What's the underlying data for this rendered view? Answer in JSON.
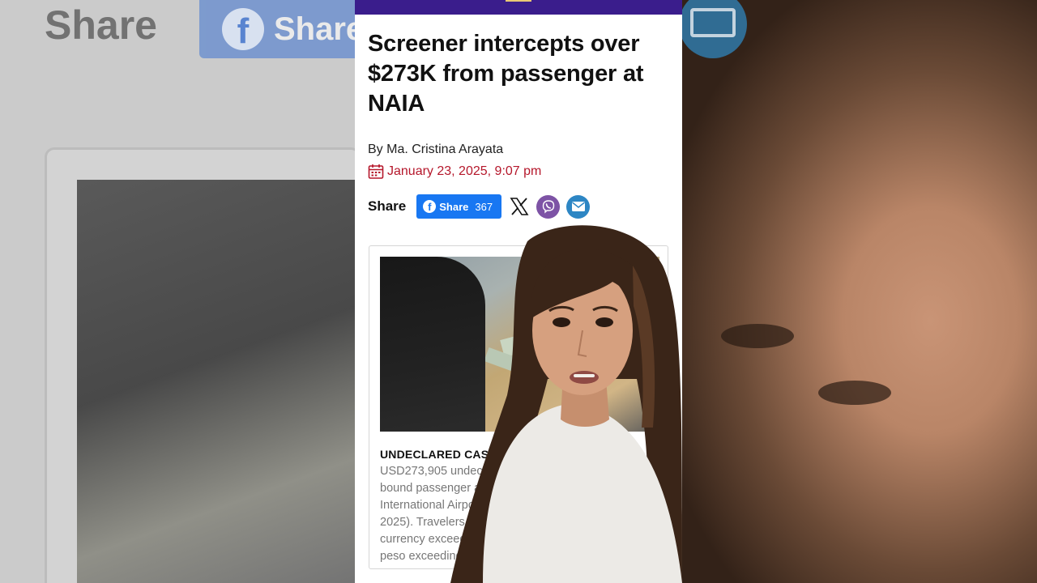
{
  "background": {
    "share_word": "Share",
    "fb_share_word": "Share"
  },
  "article": {
    "headline": "Screener intercepts over $273K from passenger at NAIA",
    "byline": "By Ma. Cristina Arayata",
    "date": "January 23, 2025, 9:07 pm",
    "share": {
      "label": "Share",
      "facebook_label": "Share",
      "facebook_count": "367",
      "icons": [
        "facebook-icon",
        "x-icon",
        "viber-icon",
        "email-icon"
      ]
    },
    "caption": {
      "title": "UNDECLARED CAS",
      "body_lines": [
        "USD273,905 undec",
        "bound passenger a",
        "International Airpo",
        "2025). Travelers a",
        "currency exceed",
        "peso exceeding        0. (P"
      ]
    }
  },
  "colors": {
    "topbar": "#3a1d8c",
    "date_red": "#b5172b",
    "facebook_blue": "#1877f2",
    "viber_purple": "#7d53a5",
    "mail_blue": "#2d86c4"
  }
}
